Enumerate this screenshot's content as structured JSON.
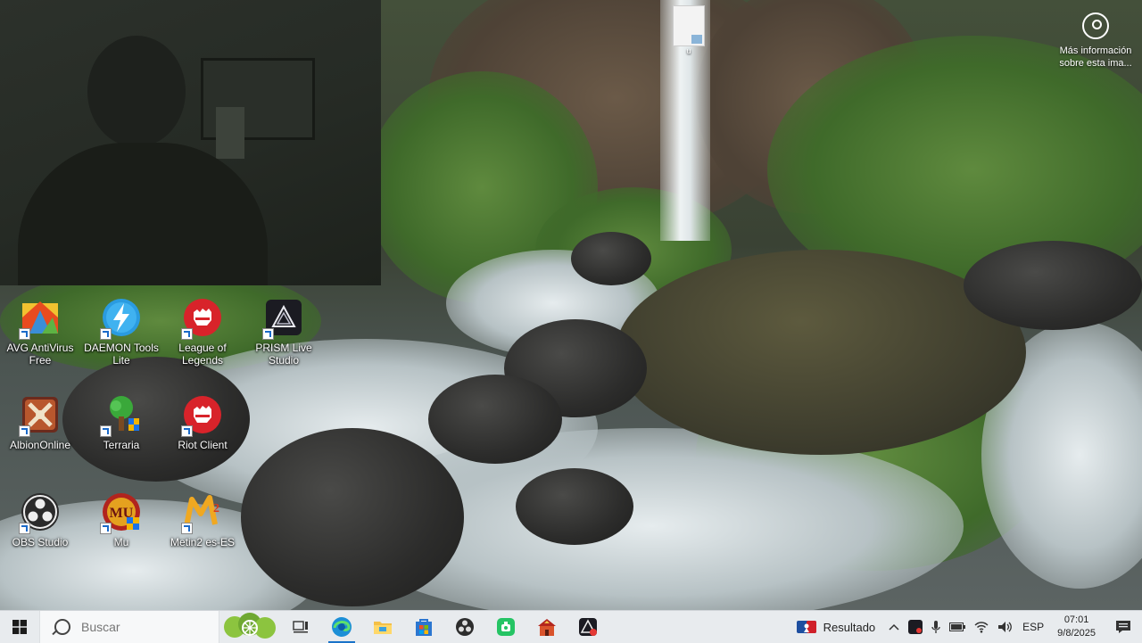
{
  "wallpaper": {
    "info_button": {
      "label": "Más información sobre esta ima..."
    }
  },
  "stray_file": {
    "label": "u"
  },
  "desktop_icons": [
    {
      "label": "AVG AntiVirus Free",
      "icon": "avg-icon"
    },
    {
      "label": "DAEMON Tools Lite",
      "icon": "daemon-tools-icon"
    },
    {
      "label": "League of Legends",
      "icon": "league-of-legends-icon"
    },
    {
      "label": "PRISM Live Studio",
      "icon": "prism-live-icon"
    },
    {
      "label": "AlbionOnline",
      "icon": "albion-online-icon"
    },
    {
      "label": "Terraria",
      "icon": "terraria-icon"
    },
    {
      "label": "Riot Client",
      "icon": "riot-client-icon"
    },
    {
      "label": "OBS Studio",
      "icon": "obs-studio-icon"
    },
    {
      "label": "Mu",
      "icon": "mu-icon"
    },
    {
      "label": "Metin2 es-ES",
      "icon": "metin2-icon"
    }
  ],
  "taskbar": {
    "search_placeholder": "Buscar",
    "apps": [
      {
        "name": "task-view",
        "icon": "task-view-icon"
      },
      {
        "name": "edge",
        "icon": "edge-icon",
        "active": true
      },
      {
        "name": "file-explorer",
        "icon": "folder-icon"
      },
      {
        "name": "microsoft-store",
        "icon": "store-icon"
      },
      {
        "name": "obs",
        "icon": "obs-icon"
      },
      {
        "name": "whatsapp",
        "icon": "whatsapp-icon"
      },
      {
        "name": "game-launcher",
        "icon": "house-icon"
      },
      {
        "name": "prism",
        "icon": "prism-icon"
      }
    ],
    "weather": {
      "label": "Resultado"
    },
    "tray": {
      "language": "ESP"
    },
    "clock": {
      "time": "07:01",
      "date": "9/8/2025"
    }
  },
  "colors": {
    "taskbar_bg": "#e8ebee",
    "accent": "#1a73c9"
  }
}
